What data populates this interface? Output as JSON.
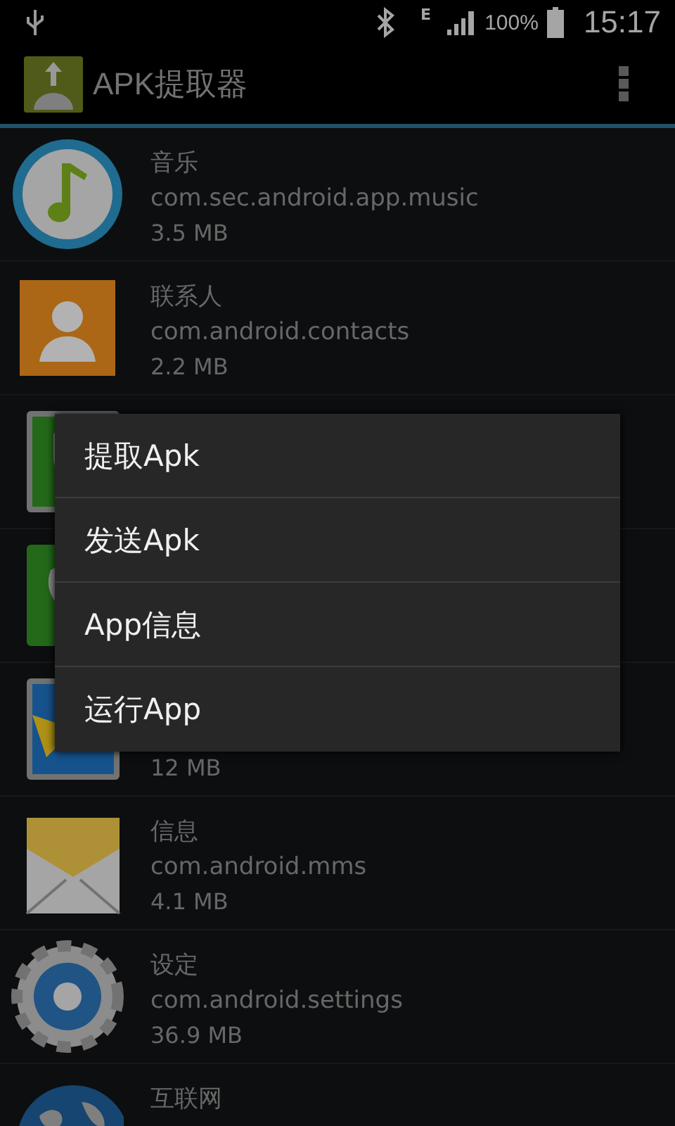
{
  "status_bar": {
    "battery": "100%",
    "network": "E",
    "time": "15:17"
  },
  "action_bar": {
    "title": "APK提取器"
  },
  "apps": [
    {
      "name": "音乐",
      "package": "com.sec.android.app.music",
      "size": "3.5 MB"
    },
    {
      "name": "联系人",
      "package": "com.android.contacts",
      "size": "2.2 MB"
    },
    {
      "kind": "picture"
    },
    {
      "kind": "picture"
    },
    {
      "size": "12 MB"
    },
    {
      "name": "信息",
      "package": "com.android.mms",
      "size": "4.1 MB"
    },
    {
      "name": "设定",
      "package": "com.android.settings",
      "size": "36.9 MB"
    },
    {
      "name": "互联网"
    }
  ],
  "context_menu": {
    "items": [
      "提取Apk",
      "发送Apk",
      "App信息",
      "运行App"
    ]
  }
}
